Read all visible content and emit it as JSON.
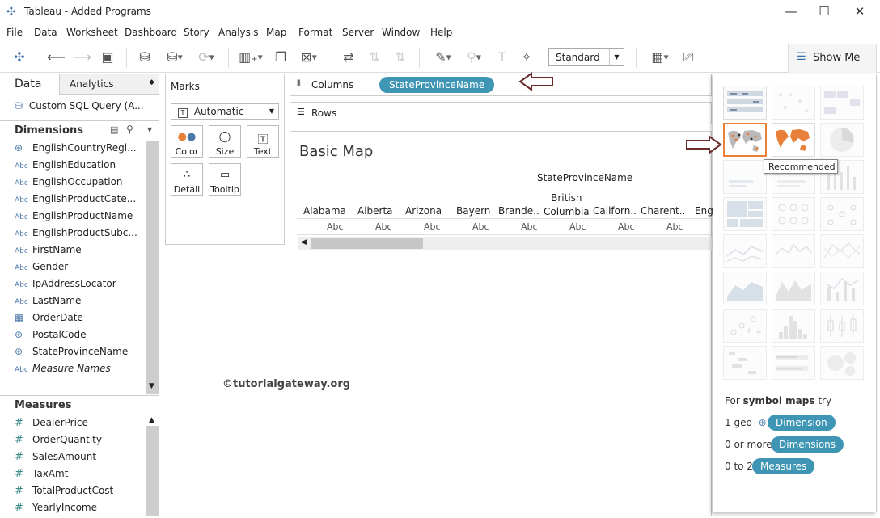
{
  "window": {
    "title": "Tableau - Added Programs",
    "minimize": "—",
    "maximize": "☐",
    "close": "✕"
  },
  "menu": [
    "File",
    "Data",
    "Worksheet",
    "Dashboard",
    "Story",
    "Analysis",
    "Map",
    "Format",
    "Server",
    "Window",
    "Help"
  ],
  "toolbar": {
    "fit_select": "Standard",
    "show_me_label": "Show Me"
  },
  "data_pane": {
    "tab_data": "Data",
    "tab_analytics": "Analytics",
    "datasource": "Custom SQL Query (A...",
    "dimensions_header": "Dimensions",
    "dimensions": [
      {
        "icon": "globe",
        "label": "EnglishCountryRegi..."
      },
      {
        "icon": "abc",
        "label": "EnglishEducation"
      },
      {
        "icon": "abc",
        "label": "EnglishOccupation"
      },
      {
        "icon": "abc",
        "label": "EnglishProductCate..."
      },
      {
        "icon": "abc",
        "label": "EnglishProductName"
      },
      {
        "icon": "abc",
        "label": "EnglishProductSubc..."
      },
      {
        "icon": "abc",
        "label": "FirstName"
      },
      {
        "icon": "abc",
        "label": "Gender"
      },
      {
        "icon": "abc",
        "label": "IpAddressLocator"
      },
      {
        "icon": "abc",
        "label": "LastName"
      },
      {
        "icon": "date",
        "label": "OrderDate"
      },
      {
        "icon": "globe",
        "label": "PostalCode"
      },
      {
        "icon": "globe",
        "label": "StateProvinceName"
      },
      {
        "icon": "abc",
        "label": "Measure Names"
      }
    ],
    "measures_header": "Measures",
    "measures": [
      "DealerPrice",
      "OrderQuantity",
      "SalesAmount",
      "TaxAmt",
      "TotalProductCost",
      "YearlyIncome"
    ]
  },
  "marks": {
    "title": "Marks",
    "type": "Automatic",
    "buttons": [
      "Color",
      "Size",
      "Text",
      "Detail",
      "Tooltip"
    ]
  },
  "shelves": {
    "columns_label": "Columns",
    "columns_pill": "StateProvinceName",
    "rows_label": "Rows"
  },
  "view": {
    "title": "Basic Map",
    "header": "StateProvinceName",
    "columns": [
      "Alabama",
      "Alberta",
      "Arizona",
      "Bayern",
      "Brande..",
      "British\nColumbia",
      "Californ..",
      "Charent..",
      "Eng"
    ],
    "cell": "Abc",
    "watermark": "©tutorialgateway.org"
  },
  "show_me": {
    "tooltip": "Recommended",
    "hint_prefix": "For ",
    "hint_bold": "symbol maps",
    "hint_suffix": " try",
    "req1_prefix": "1 geo",
    "req1_pill": "Dimension",
    "req2_prefix": "0 or more",
    "req2_pill": "Dimensions",
    "req3_prefix": "0 to 2",
    "req3_pill": "Measures"
  },
  "colors": {
    "pill": "#3f96b4",
    "accent_orange": "#e8803a",
    "annotation_arrow": "#6b2b2b"
  }
}
